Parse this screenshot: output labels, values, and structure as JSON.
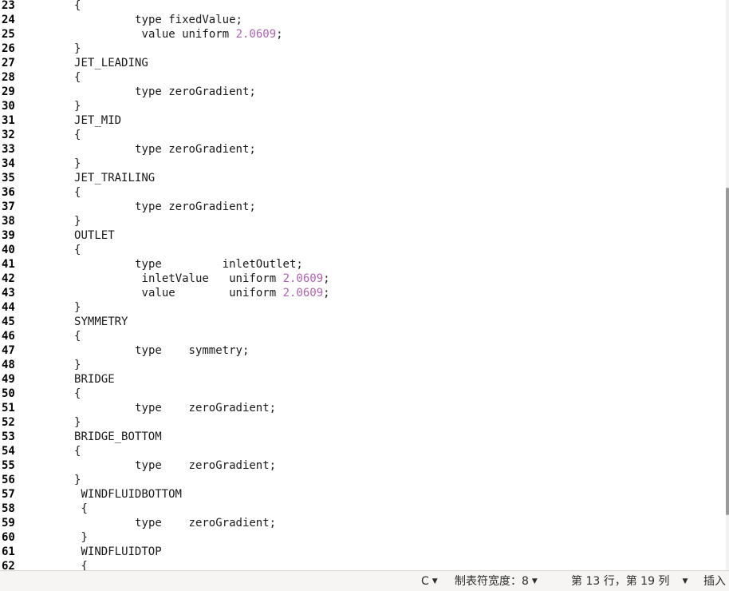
{
  "editor": {
    "lines": [
      {
        "n": "23",
        "indent": "         ",
        "text": "{",
        "num": ""
      },
      {
        "n": "24",
        "indent": "                  ",
        "text": "type fixedValue;",
        "num": ""
      },
      {
        "n": "25",
        "indent": "                   ",
        "text": "value uniform ",
        "num": "2.0609",
        "tail": ";"
      },
      {
        "n": "26",
        "indent": "         ",
        "text": "}",
        "num": ""
      },
      {
        "n": "27",
        "indent": "         ",
        "text": "JET_LEADING",
        "num": ""
      },
      {
        "n": "28",
        "indent": "         ",
        "text": "{",
        "num": ""
      },
      {
        "n": "29",
        "indent": "                  ",
        "text": "type zeroGradient;",
        "num": ""
      },
      {
        "n": "30",
        "indent": "         ",
        "text": "}",
        "num": ""
      },
      {
        "n": "31",
        "indent": "         ",
        "text": "JET_MID",
        "num": ""
      },
      {
        "n": "32",
        "indent": "         ",
        "text": "{",
        "num": ""
      },
      {
        "n": "33",
        "indent": "                  ",
        "text": "type zeroGradient;",
        "num": ""
      },
      {
        "n": "34",
        "indent": "         ",
        "text": "}",
        "num": ""
      },
      {
        "n": "35",
        "indent": "         ",
        "text": "JET_TRAILING",
        "num": ""
      },
      {
        "n": "36",
        "indent": "         ",
        "text": "{",
        "num": ""
      },
      {
        "n": "37",
        "indent": "                  ",
        "text": "type zeroGradient;",
        "num": ""
      },
      {
        "n": "38",
        "indent": "         ",
        "text": "}",
        "num": ""
      },
      {
        "n": "39",
        "indent": "         ",
        "text": "OUTLET",
        "num": ""
      },
      {
        "n": "40",
        "indent": "         ",
        "text": "{",
        "num": ""
      },
      {
        "n": "41",
        "indent": "                  ",
        "text": "type         inletOutlet;",
        "num": ""
      },
      {
        "n": "42",
        "indent": "                   ",
        "text": "inletValue   uniform ",
        "num": "2.0609",
        "tail": ";"
      },
      {
        "n": "43",
        "indent": "                   ",
        "text": "value        uniform ",
        "num": "2.0609",
        "tail": ";"
      },
      {
        "n": "44",
        "indent": "         ",
        "text": "}",
        "num": ""
      },
      {
        "n": "45",
        "indent": "         ",
        "text": "SYMMETRY",
        "num": ""
      },
      {
        "n": "46",
        "indent": "         ",
        "text": "{",
        "num": ""
      },
      {
        "n": "47",
        "indent": "                  ",
        "text": "type    symmetry;",
        "num": ""
      },
      {
        "n": "48",
        "indent": "         ",
        "text": "}",
        "num": ""
      },
      {
        "n": "49",
        "indent": "         ",
        "text": "BRIDGE",
        "num": ""
      },
      {
        "n": "50",
        "indent": "         ",
        "text": "{",
        "num": ""
      },
      {
        "n": "51",
        "indent": "                  ",
        "text": "type    zeroGradient;",
        "num": ""
      },
      {
        "n": "52",
        "indent": "         ",
        "text": "}",
        "num": ""
      },
      {
        "n": "53",
        "indent": "         ",
        "text": "BRIDGE_BOTTOM",
        "num": ""
      },
      {
        "n": "54",
        "indent": "         ",
        "text": "{",
        "num": ""
      },
      {
        "n": "55",
        "indent": "                  ",
        "text": "type    zeroGradient;",
        "num": ""
      },
      {
        "n": "56",
        "indent": "         ",
        "text": "}",
        "num": ""
      },
      {
        "n": "57",
        "indent": "          ",
        "text": "WINDFLUIDBOTTOM",
        "num": ""
      },
      {
        "n": "58",
        "indent": "          ",
        "text": "{",
        "num": ""
      },
      {
        "n": "59",
        "indent": "                  ",
        "text": "type    zeroGradient;",
        "num": ""
      },
      {
        "n": "60",
        "indent": "          ",
        "text": "}",
        "num": ""
      },
      {
        "n": "61",
        "indent": "          ",
        "text": "WINDFLUIDTOP",
        "num": ""
      },
      {
        "n": "62",
        "indent": "          ",
        "text": "{",
        "num": ""
      }
    ]
  },
  "statusbar": {
    "language": "C",
    "tab_width": "制表符宽度：8",
    "position": "第 13 行，第 19 列",
    "mode": "插入"
  },
  "colors": {
    "number": "#b062b4"
  }
}
